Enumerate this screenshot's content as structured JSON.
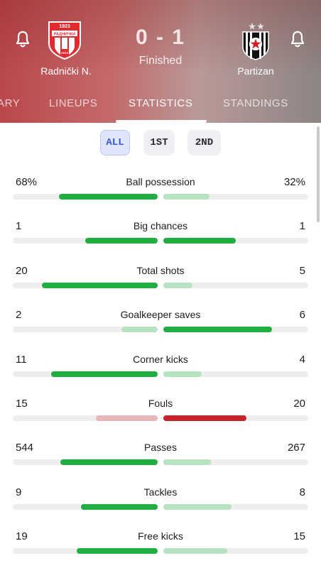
{
  "match": {
    "home_team": "Radnički N.",
    "away_team": "Partizan",
    "score": "0 - 1",
    "status": "Finished",
    "home_crest": {
      "year": "1923",
      "text": "РАДНИЧКИ",
      "city": "НИШ"
    }
  },
  "tabs": [
    {
      "label": "ARY",
      "active": false
    },
    {
      "label": "LINEUPS",
      "active": false
    },
    {
      "label": "STATISTICS",
      "active": true
    },
    {
      "label": "STANDINGS",
      "active": false
    }
  ],
  "periods": [
    {
      "label": "ALL",
      "active": true
    },
    {
      "label": "1ST",
      "active": false
    },
    {
      "label": "2ND",
      "active": false
    }
  ],
  "colors": {
    "win_green": "#1fae3f",
    "lose_green_light": "#b8e3c2",
    "win_red": "#c8232b",
    "lose_red_light": "#e7b6b6",
    "active_period_blue": "#3b58d4"
  },
  "stats": [
    {
      "label": "Ball possession",
      "home": "68%",
      "away": "32%",
      "home_frac": 0.68,
      "away_frac": 0.32,
      "leader": "home",
      "theme": "green"
    },
    {
      "label": "Big chances",
      "home": "1",
      "away": "1",
      "home_frac": 0.5,
      "away_frac": 0.5,
      "leader": "both",
      "theme": "green"
    },
    {
      "label": "Total shots",
      "home": "20",
      "away": "5",
      "home_frac": 0.8,
      "away_frac": 0.2,
      "leader": "home",
      "theme": "green"
    },
    {
      "label": "Goalkeeper saves",
      "home": "2",
      "away": "6",
      "home_frac": 0.25,
      "away_frac": 0.75,
      "leader": "away",
      "theme": "green"
    },
    {
      "label": "Corner kicks",
      "home": "11",
      "away": "4",
      "home_frac": 0.733,
      "away_frac": 0.267,
      "leader": "home",
      "theme": "green"
    },
    {
      "label": "Fouls",
      "home": "15",
      "away": "20",
      "home_frac": 0.4286,
      "away_frac": 0.5714,
      "leader": "away",
      "theme": "red"
    },
    {
      "label": "Passes",
      "home": "544",
      "away": "267",
      "home_frac": 0.6708,
      "away_frac": 0.3292,
      "leader": "home",
      "theme": "green"
    },
    {
      "label": "Tackles",
      "home": "9",
      "away": "8",
      "home_frac": 0.5294,
      "away_frac": 0.4706,
      "leader": "home",
      "theme": "green"
    },
    {
      "label": "Free kicks",
      "home": "19",
      "away": "15",
      "home_frac": 0.5588,
      "away_frac": 0.4412,
      "leader": "home",
      "theme": "green"
    }
  ]
}
